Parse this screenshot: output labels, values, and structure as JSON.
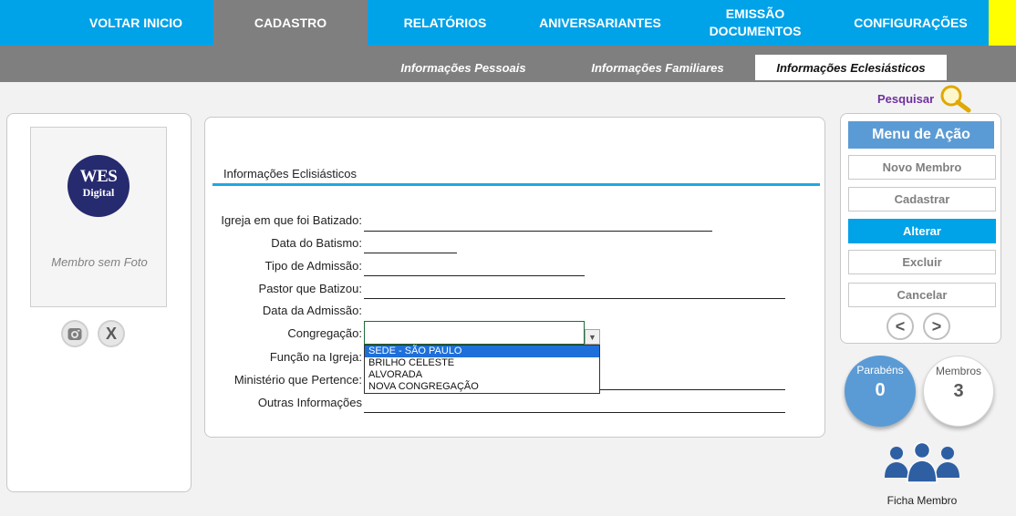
{
  "nav": {
    "items": [
      {
        "label": "VOLTAR INICIO"
      },
      {
        "label": "CADASTRO"
      },
      {
        "label": "RELATÓRIOS"
      },
      {
        "label": "ANIVERSARIANTES"
      },
      {
        "label": "EMISSÃO DOCUMENTOS"
      },
      {
        "label": "CONFIGURAÇÕES"
      }
    ],
    "active_index": 1
  },
  "subnav": {
    "tabs": [
      {
        "label": "Informações Pessoais"
      },
      {
        "label": "Informações Familiares"
      },
      {
        "label": "Informações Eclesiásticos"
      }
    ],
    "active_index": 2
  },
  "search": {
    "label": "Pesquisar",
    "icon": "magnifier-icon"
  },
  "photo": {
    "logo_line1": "WES",
    "logo_line2": "Digital",
    "placeholder": "Membro sem Foto",
    "camera_icon": "camera-icon",
    "remove_label": "X"
  },
  "form": {
    "title": "Informações Eclisiásticos",
    "fields": {
      "igreja": "Igreja em que foi Batizado:",
      "data_batismo": "Data do Batismo:",
      "tipo_admissao": "Tipo de Admissão:",
      "pastor": "Pastor que Batizou:",
      "data_admissao": "Data da Admissão:",
      "congregacao": "Congregação:",
      "funcao": "Função na Igreja:",
      "ministerio": "Ministério que Pertence:",
      "outras": "Outras Informações"
    },
    "congregacao_value": "",
    "congregacao_options": [
      "SEDE - SÃO PAULO",
      "BRILHO CELESTE",
      "ALVORADA",
      "NOVA CONGREGAÇÃO"
    ],
    "congregacao_highlighted": 0
  },
  "action_menu": {
    "title": "Menu de Ação",
    "buttons": [
      {
        "label": "Novo Membro"
      },
      {
        "label": "Cadastrar"
      },
      {
        "label": "Alterar"
      },
      {
        "label": "Excluir"
      },
      {
        "label": "Cancelar"
      }
    ],
    "active_index": 2,
    "prev": "<",
    "next": ">"
  },
  "stats": {
    "parabens_label": "Parabéns",
    "parabens_value": "0",
    "membros_label": "Membros",
    "membros_value": "3"
  },
  "ficha": {
    "label": "Ficha Membro",
    "icon": "users-group-icon"
  },
  "colors": {
    "nav_blue": "#00a2e8",
    "nav_active": "#7f7f7f",
    "accent_yellow": "#ffff00",
    "action_title": "#5b9bd5",
    "search_purple": "#7030a0"
  }
}
